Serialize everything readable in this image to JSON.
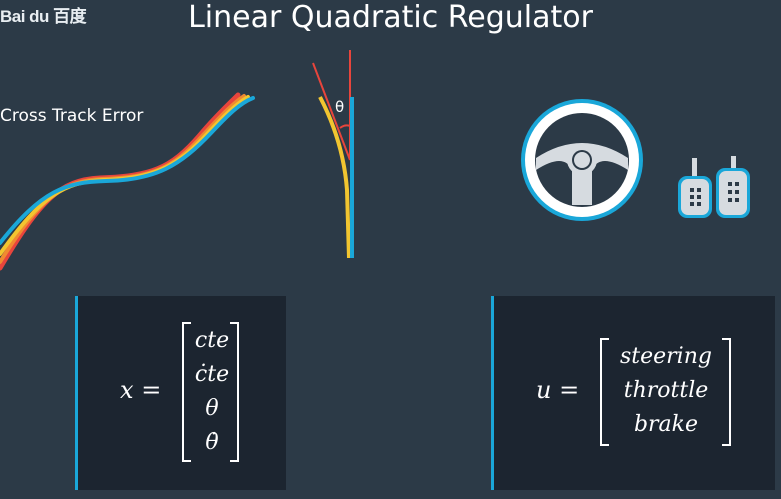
{
  "watermark": "Bai du 百度",
  "title": "Linear Quadratic Regulator",
  "cte_label": "Cross Track Error",
  "theta_label": "θ",
  "state_equation": {
    "lhs": "x",
    "equals": "=",
    "entries": [
      "cte",
      "ċte",
      "θ",
      "θ̇"
    ]
  },
  "control_equation": {
    "lhs": "u",
    "equals": "=",
    "entries": [
      "steering",
      "throttle",
      "brake"
    ]
  },
  "colors": {
    "background": "#2c3a47",
    "panel": "#1c2530",
    "accent_blue": "#1aa7d9",
    "red_path": "#e8453c",
    "yellow_path": "#f2c530",
    "orange_path": "#f08a30"
  },
  "icons": [
    "steering-wheel-icon",
    "pedals-icon"
  ]
}
